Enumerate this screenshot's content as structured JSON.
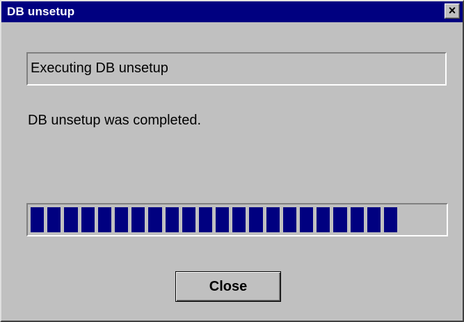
{
  "window": {
    "title": "DB unsetup",
    "close_glyph": "×",
    "close_icon": "close-icon"
  },
  "status_box": {
    "text": "Executing DB unsetup"
  },
  "message": {
    "text": "DB unsetup was completed."
  },
  "progress": {
    "fraction": 1.0,
    "block_count": 22,
    "color": "#000080"
  },
  "buttons": {
    "close_label": "Close"
  },
  "colors": {
    "titlebar": "#000080",
    "face": "#c0c0c0"
  }
}
